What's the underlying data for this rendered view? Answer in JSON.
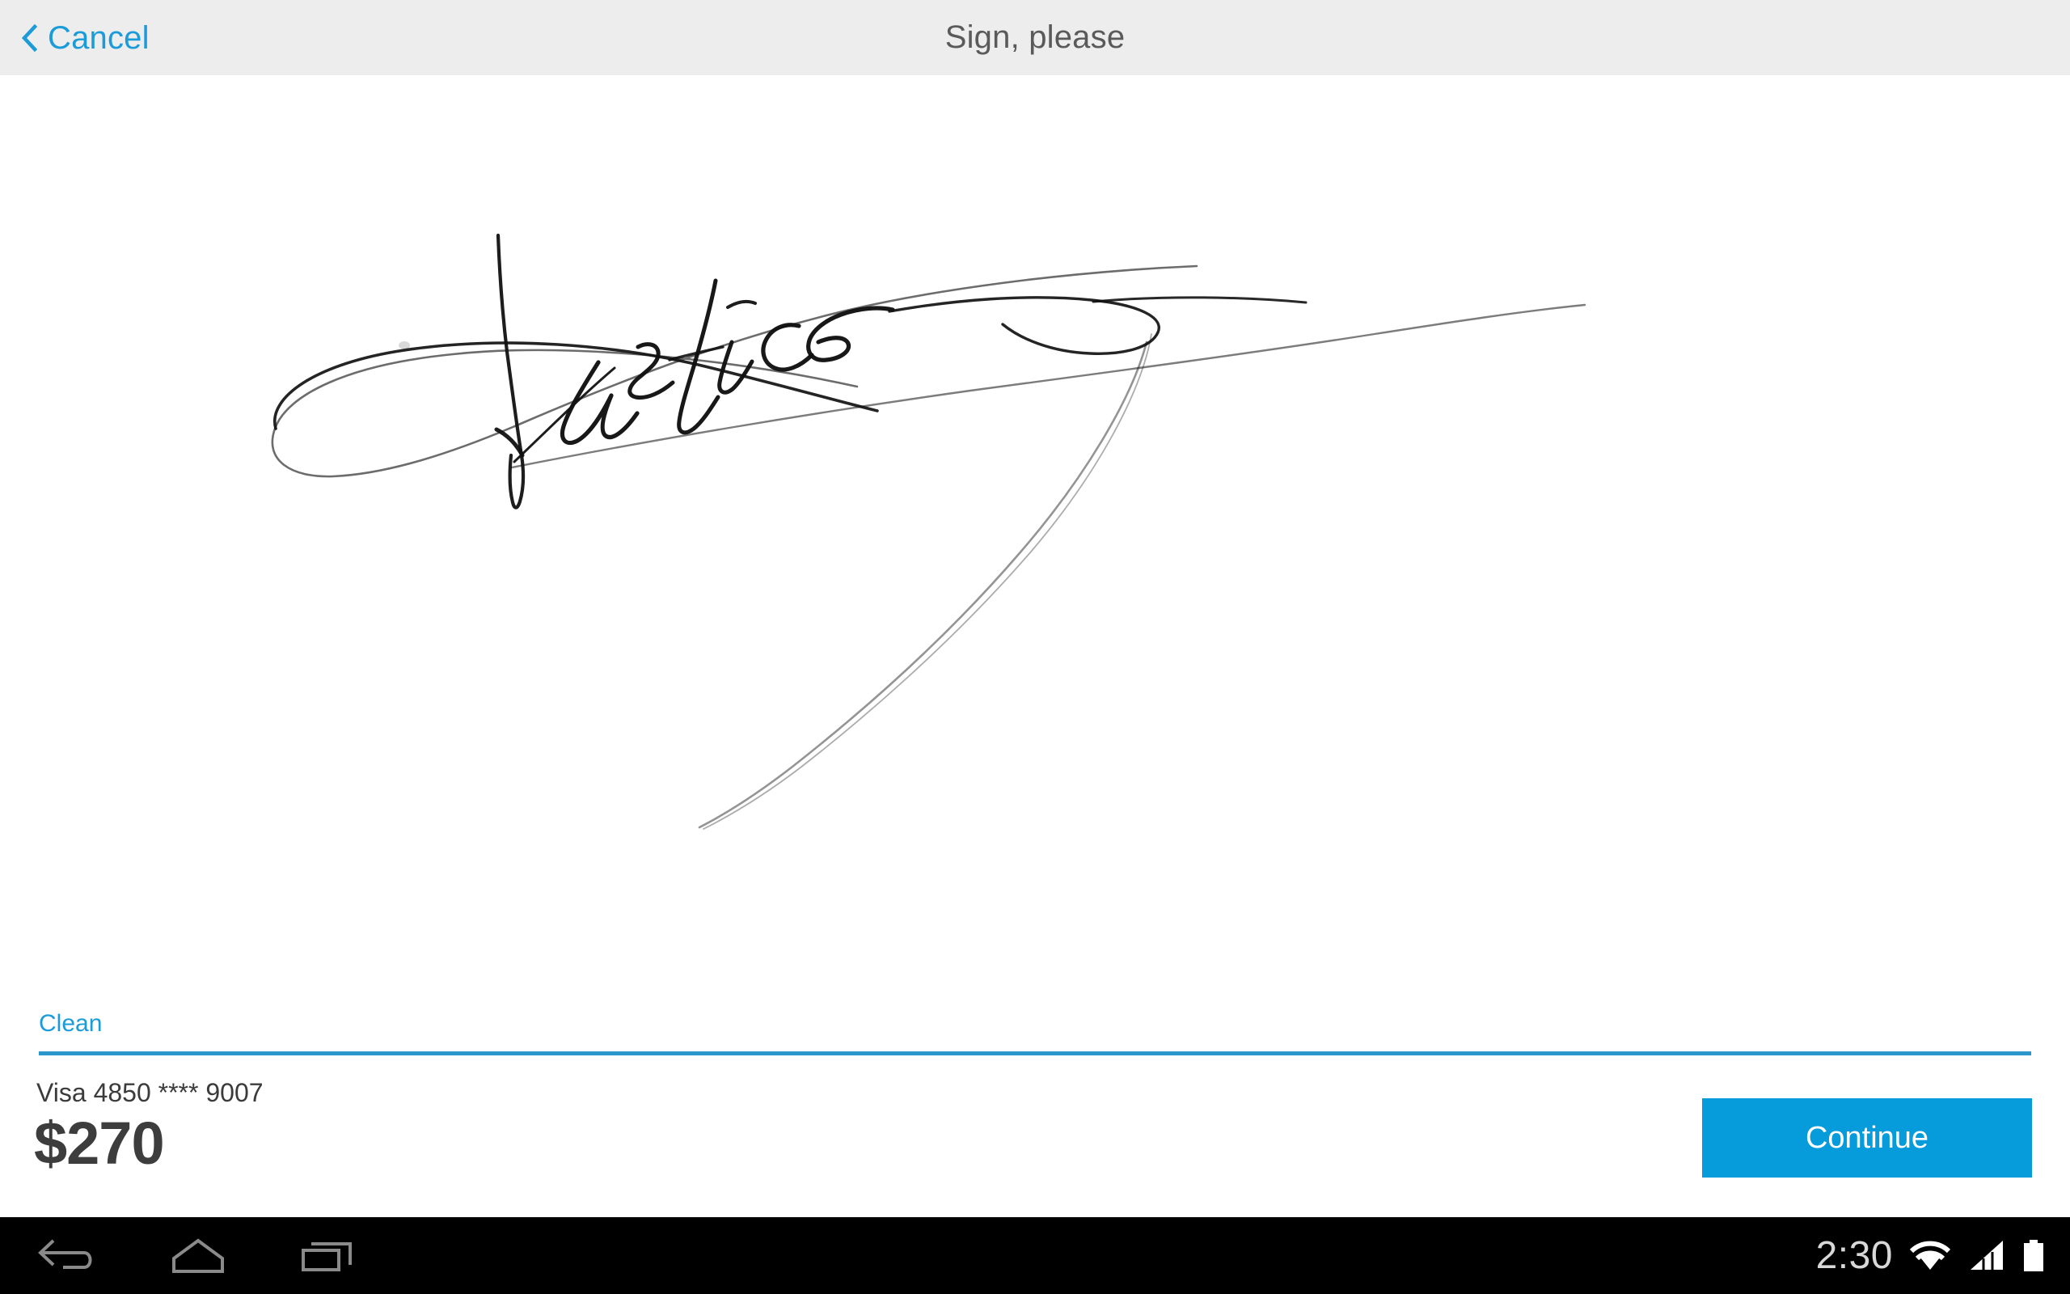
{
  "header": {
    "cancel_label": "Cancel",
    "cancel_icon": "chevron-left-icon",
    "title": "Sign, please"
  },
  "signature": {
    "canvas_label": "signature-drawing-area",
    "ink_color": "#111111",
    "rendered_text": "Justice",
    "has_drawing": true
  },
  "footer": {
    "clean_label": "Clean",
    "divider_color": "#2b96cc",
    "card_label": "Visa 4850 **** 9007",
    "amount": "$270",
    "continue_label": "Continue",
    "continue_color": "#069bda"
  },
  "system_nav": {
    "back_icon": "back-arrow-icon",
    "home_icon": "home-icon",
    "recents_icon": "recent-apps-icon",
    "clock": "2:30",
    "wifi_icon": "wifi-icon",
    "signal_icon": "cell-signal-icon",
    "battery_icon": "battery-full-icon"
  },
  "colors": {
    "accent_blue": "#1b9bd8",
    "header_bg": "#ededed",
    "nav_bg": "#000000",
    "title_gray": "#5a5a5a"
  }
}
